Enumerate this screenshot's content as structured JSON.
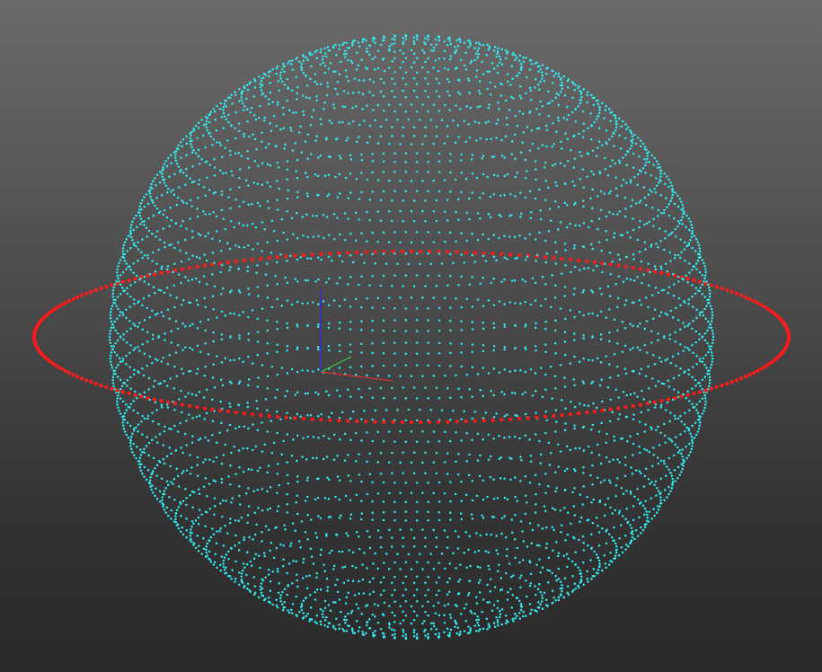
{
  "viewport": {
    "background_top": "#6a6a6a",
    "background_bottom": "#2a2a2a"
  },
  "sphere_particles": {
    "color": "#33e8ee",
    "shape": "point-cloud-sphere"
  },
  "ring_particles": {
    "color": "#ff1a1a",
    "shape": "point-cloud-ring"
  },
  "axis_gizmo": {
    "x_color": "#d83030",
    "y_color": "#3ccf3c",
    "z_color": "#3030d8"
  }
}
